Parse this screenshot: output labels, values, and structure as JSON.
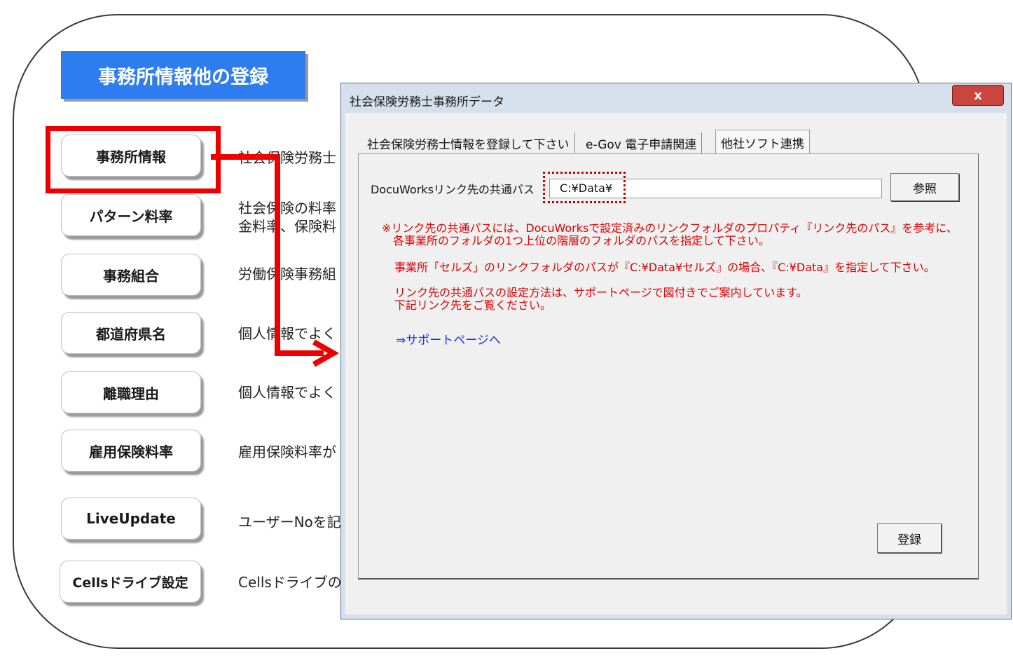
{
  "main": {
    "title": "事務所情報他の登録",
    "menu": [
      {
        "label": "事務所情報",
        "desc": "社会保険労務士"
      },
      {
        "label": "パターン料率",
        "desc": "社会保険の料率\n金料率、保険料"
      },
      {
        "label": "事務組合",
        "desc": "労働保険事務組"
      },
      {
        "label": "都道府県名",
        "desc": "個人情報でよく"
      },
      {
        "label": "離職理由",
        "desc": "個人情報でよく"
      },
      {
        "label": "雇用保険料率",
        "desc": "雇用保険料率が"
      },
      {
        "label": "LiveUpdate",
        "desc": "ユーザーNoを記"
      },
      {
        "label": "Cellsドライブ設定",
        "desc": "Cellsドライブの"
      }
    ]
  },
  "dialog": {
    "title": "社会保険労務士事務所データ",
    "close_label": "x",
    "tabs": [
      {
        "label": "社会保険労務士情報を登録して下さい"
      },
      {
        "label": "e-Gov 電子申請関連"
      },
      {
        "label": "他社ソフト連携"
      }
    ],
    "path_label": "DocuWorksリンク先の共通パス",
    "path_value": "C:¥Data¥",
    "browse_label": "参照",
    "notes": [
      "※リンク先の共通パスには、DocuWorksで設定済みのリンクフォルダのプロパティ『リンク先のパス』を参考に、\n　各事業所のフォルダの1つ上位の階層のフォルダのパスを指定して下さい。",
      "事業所「セルズ」のリンクフォルダのパスが『C:¥Data¥セルズ』の場合、『C:¥Data』を指定して下さい。",
      "リンク先の共通パスの設定方法は、サポートページで図付きでご案内しています。\n下記リンク先をご覧ください。"
    ],
    "support_link": "⇒サポートページへ",
    "register_label": "登録"
  },
  "colors": {
    "title_bg": "#2e7df0",
    "highlight": "#ee0000",
    "note_text": "#e00000",
    "link_text": "#1a33e6"
  }
}
